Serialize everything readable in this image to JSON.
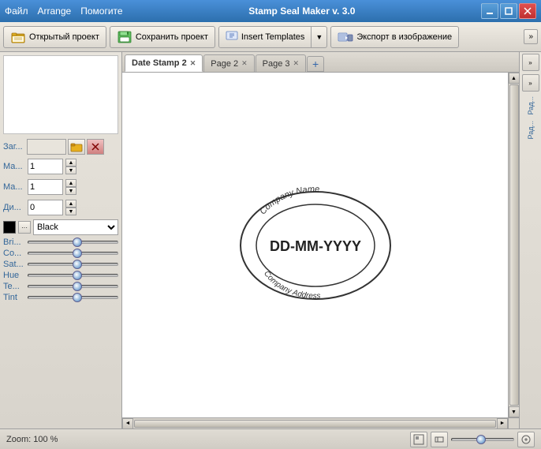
{
  "window": {
    "title": "Stamp Seal Maker v. 3.0",
    "menu": [
      "Файл",
      "Arrange",
      "Помогите"
    ],
    "controls": [
      "▣",
      "▢",
      "✕"
    ]
  },
  "toolbar": {
    "open_project": "Открытый проект",
    "save_project": "Сохранить проект",
    "insert_templates": "Insert Templates",
    "export": "Экспорт в изображение",
    "overflow": "»"
  },
  "tabs": [
    {
      "label": "Date Stamp 2",
      "active": true
    },
    {
      "label": "Page 2",
      "active": false
    },
    {
      "label": "Page 3",
      "active": false
    }
  ],
  "left_panel": {
    "props": [
      {
        "label": "Заг...",
        "value": ""
      },
      {
        "label": "Ма...",
        "value": "1"
      },
      {
        "label": "Ма...",
        "value": "1"
      },
      {
        "label": "Ди...",
        "value": "0"
      }
    ],
    "color_label": "Black",
    "sliders": [
      {
        "label": "Bri...",
        "pos": 55
      },
      {
        "label": "Co...",
        "pos": 55
      },
      {
        "label": "Sat...",
        "pos": 55
      },
      {
        "label": "Hue",
        "pos": 55
      },
      {
        "label": "Te...",
        "pos": 55
      },
      {
        "label": "Tint",
        "pos": 55
      }
    ]
  },
  "stamp": {
    "company_name": "Company Name",
    "date_text": "DD-MM-YYYY",
    "company_address": "Company Address"
  },
  "right_panel": {
    "btn1": "»",
    "btn2": "»",
    "label1": "Рад...",
    "label2": "Рад..."
  },
  "statusbar": {
    "zoom_label": "Zoom: 100 %"
  }
}
